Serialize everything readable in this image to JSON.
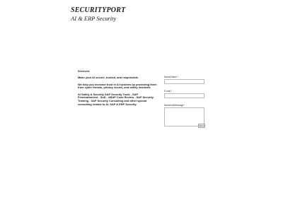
{
  "brand": {
    "name": "SECURITYPORT",
    "tagline": "AI & ERP Security"
  },
  "main": {
    "heading": "Services:",
    "paragraphs": [
      "Make your AI secure, trusted, and responsible.",
      "We help you increase trust in AI systems by protecting them from cyber threats, privacy issues, and safety incidents",
      "AI Safety & Security SAP Security Tools - SAP Penetrationtest - SoD - ABAP Code Review - SAP Security Training - SAP Security Consulting and other special consulting related to AI, SAP & ERP Security."
    ]
  },
  "contact_form": {
    "name_label": "Name/Name *",
    "email_label": "E-mail *",
    "message_label": "Nachricht/Message *",
    "submit_label": "Send"
  }
}
